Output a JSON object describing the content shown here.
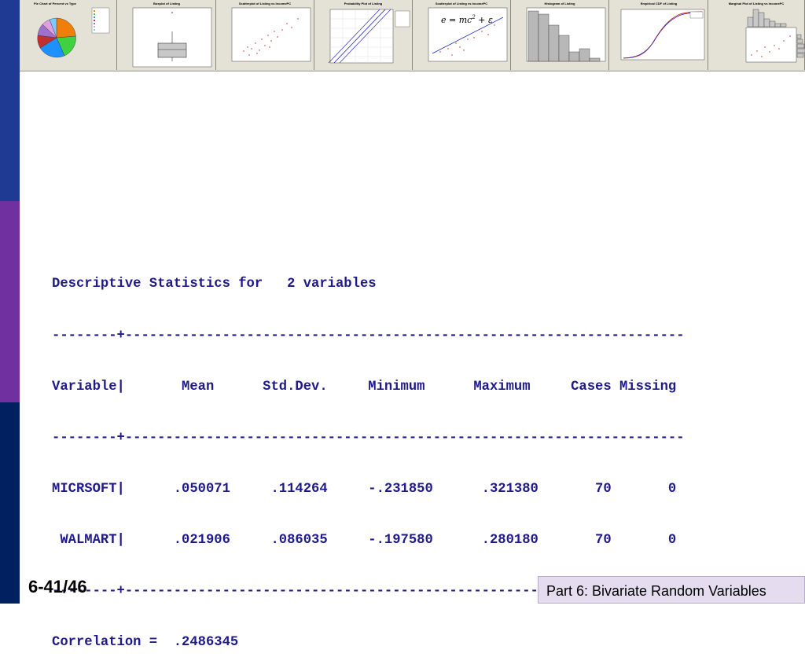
{
  "thumbnails": {
    "pie_title": "Pie Chart of Percent vs Type",
    "boxplot_title": "Boxplot of Listing",
    "scatter1_title": "Scatterplot of Listing vs IncomePC",
    "probplot_title": "Probability Plot of Listing",
    "scatter2_title": "Scatterplot of Listing vs IncomePC",
    "formula_lhs": "e = mc",
    "formula_exp": "2",
    "formula_rhs": " + ε",
    "histogram_title": "Histogram of Listing",
    "cdf_title": "Empirical CDF of Listing",
    "marginal_title": "Marginal Plot of Listing vs IncomePC"
  },
  "stats": {
    "title_line": "Descriptive Statistics for   2 variables",
    "separator_line": "--------+---------------------------------------------------------------------",
    "header_line": "Variable|       Mean      Std.Dev.     Minimum      Maximum     Cases Missing",
    "row1_line": "MICRSOFT|      .050071     .114264     -.231850      .321380       70       0",
    "row2_line": " WALMART|      .021906     .086035     -.197580      .280180       70       0",
    "correlation_line": "Correlation =  .2486345",
    "columns": [
      "Variable",
      "Mean",
      "Std.Dev.",
      "Minimum",
      "Maximum",
      "Cases",
      "Missing"
    ],
    "rows": [
      {
        "variable": "MICRSOFT",
        "mean": ".050071",
        "std_dev": ".114264",
        "minimum": "-.231850",
        "maximum": ".321380",
        "cases": "70",
        "missing": "0"
      },
      {
        "variable": "WALMART",
        "mean": ".021906",
        "std_dev": ".086035",
        "minimum": "-.197580",
        "maximum": ".280180",
        "cases": "70",
        "missing": "0"
      }
    ],
    "correlation_label": "Correlation =",
    "correlation_value": ".2486345"
  },
  "footer": {
    "slide_number": "6-41/46",
    "title": "Part 6: Bivariate Random Variables"
  },
  "colors": {
    "sidebar_top": "#1f3a93",
    "sidebar_middle": "#7030a0",
    "sidebar_bottom": "#002060",
    "text_blue": "#1f1a8a",
    "footer_bg": "#e6dcf0"
  }
}
